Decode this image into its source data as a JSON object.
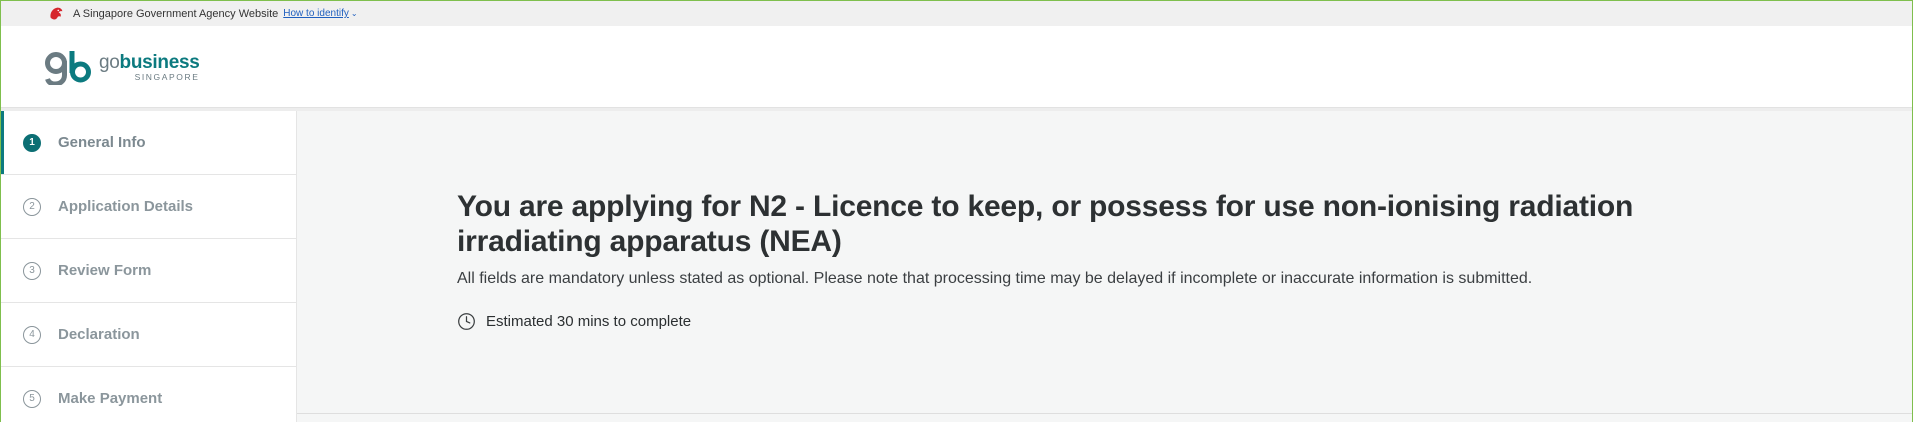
{
  "masthead": {
    "text": "A Singapore Government Agency Website",
    "link": "How to identify"
  },
  "logo": {
    "go": "go",
    "business": "business",
    "sub": "SINGAPORE"
  },
  "steps": [
    {
      "num": "1",
      "label": "General Info",
      "active": true
    },
    {
      "num": "2",
      "label": "Application Details",
      "active": false
    },
    {
      "num": "3",
      "label": "Review Form",
      "active": false
    },
    {
      "num": "4",
      "label": "Declaration",
      "active": false
    },
    {
      "num": "5",
      "label": "Make Payment",
      "active": false
    }
  ],
  "main": {
    "title": "You are applying for N2 - Licence to keep, or possess for use non-ionising radiation irradiating apparatus (NEA)",
    "subtitle": "All fields are mandatory unless stated as optional. Please note that processing time may be delayed if incomplete or inaccurate information is submitted.",
    "estimate": "Estimated 30 mins to complete"
  },
  "colors": {
    "accent": "#0c7a7f",
    "lion": "#d6262c",
    "link": "#1f5fbf"
  },
  "icons": {
    "masthead": "lion-head-icon",
    "estimate": "clock-icon"
  }
}
